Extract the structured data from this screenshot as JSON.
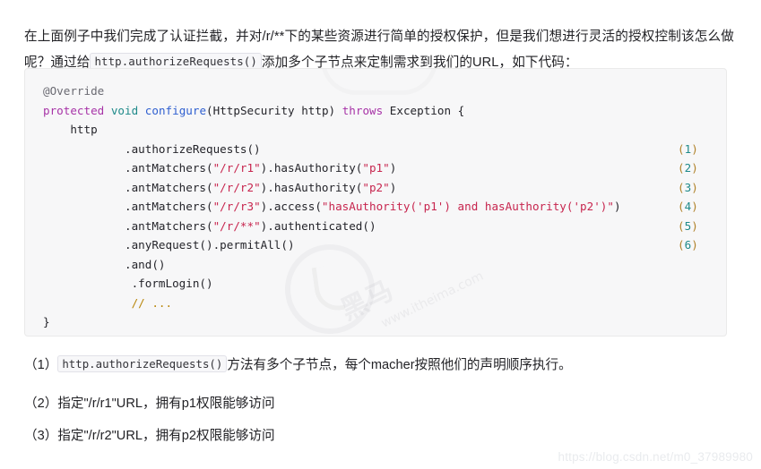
{
  "intro": {
    "part1": "在上面例子中我们完成了认证拦截，并对/r/**下的某些资源进行简单的授权保护，但是我们想进行灵活的授权控制该怎么做呢？通过给",
    "inline_code": "http.authorizeRequests()",
    "part2": "添加多个子节点来定制需求到我们的URL，如下代码："
  },
  "code_block": {
    "language": "java",
    "lines": [
      {
        "indent": 0,
        "tokens": [
          {
            "t": "@Override",
            "c": "anno"
          }
        ],
        "marker": ""
      },
      {
        "indent": 0,
        "tokens": [
          {
            "t": "protected",
            "c": "kw"
          },
          {
            "t": " ",
            "c": "plain"
          },
          {
            "t": "void",
            "c": "type"
          },
          {
            "t": " ",
            "c": "plain"
          },
          {
            "t": "configure",
            "c": "fn"
          },
          {
            "t": "(",
            "c": "punc"
          },
          {
            "t": "HttpSecurity http",
            "c": "plain"
          },
          {
            "t": ")",
            "c": "punc"
          },
          {
            "t": " ",
            "c": "plain"
          },
          {
            "t": "throws",
            "c": "kw"
          },
          {
            "t": " Exception ",
            "c": "plain"
          },
          {
            "t": "{",
            "c": "punc"
          }
        ],
        "marker": ""
      },
      {
        "indent": 1,
        "tokens": [
          {
            "t": "http",
            "c": "plain"
          }
        ],
        "marker": ""
      },
      {
        "indent": 3,
        "tokens": [
          {
            "t": ".authorizeRequests()",
            "c": "mth"
          }
        ],
        "marker": "1"
      },
      {
        "indent": 3,
        "tokens": [
          {
            "t": ".antMatchers(",
            "c": "mth"
          },
          {
            "t": "\"/r/r1\"",
            "c": "str"
          },
          {
            "t": ").hasAuthority(",
            "c": "mth"
          },
          {
            "t": "\"p1\"",
            "c": "str"
          },
          {
            "t": ")",
            "c": "mth"
          }
        ],
        "marker": "2"
      },
      {
        "indent": 3,
        "tokens": [
          {
            "t": ".antMatchers(",
            "c": "mth"
          },
          {
            "t": "\"/r/r2\"",
            "c": "str"
          },
          {
            "t": ").hasAuthority(",
            "c": "mth"
          },
          {
            "t": "\"p2\"",
            "c": "str"
          },
          {
            "t": ")",
            "c": "mth"
          }
        ],
        "marker": "3"
      },
      {
        "indent": 3,
        "tokens": [
          {
            "t": ".antMatchers(",
            "c": "mth"
          },
          {
            "t": "\"/r/r3\"",
            "c": "str"
          },
          {
            "t": ").access(",
            "c": "mth"
          },
          {
            "t": "\"hasAuthority('p1') and hasAuthority('p2')\"",
            "c": "str"
          },
          {
            "t": ")",
            "c": "mth"
          }
        ],
        "marker": "4"
      },
      {
        "indent": 3,
        "tokens": [
          {
            "t": ".antMatchers(",
            "c": "mth"
          },
          {
            "t": "\"/r/**\"",
            "c": "str"
          },
          {
            "t": ").authenticated()",
            "c": "mth"
          }
        ],
        "marker": "5"
      },
      {
        "indent": 3,
        "tokens": [
          {
            "t": ".anyRequest().permitAll()",
            "c": "mth"
          }
        ],
        "marker": "6"
      },
      {
        "indent": 3,
        "tokens": [
          {
            "t": ".and()",
            "c": "mth"
          }
        ],
        "marker": ""
      },
      {
        "indent": 3,
        "tokens": [
          {
            "t": " .formLogin()",
            "c": "mth"
          }
        ],
        "marker": ""
      },
      {
        "indent": 3,
        "tokens": [
          {
            "t": " // ...",
            "c": "cmt"
          }
        ],
        "marker": ""
      },
      {
        "indent": 0,
        "tokens": [
          {
            "t": "}",
            "c": "punc"
          }
        ],
        "marker": ""
      }
    ],
    "markers": [
      "(1)",
      "(2)",
      "(3)",
      "(4)",
      "(5)",
      "(6)"
    ]
  },
  "notes": {
    "note1_prefix": "（1）",
    "note1_code": "http.authorizeRequests()",
    "note1_suffix": "方法有多个子节点，每个macher按照他们的声明顺序执行。",
    "note2": "（2）指定\"/r/r1\"URL，拥有p1权限能够访问",
    "note3": "（3）指定\"/r/r2\"URL，拥有p2权限能够访问"
  },
  "watermarks": {
    "csdn": "https://blog.csdn.net/m0_37989980",
    "brand_cn": "黑马",
    "brand_url": "www.itheima.com"
  },
  "colors": {
    "code_bg": "#f7f7f8",
    "code_border": "#eaeaea",
    "string": "#c7254e",
    "keyword": "#a733a7",
    "type": "#1f8a8a",
    "function": "#2f5fd0",
    "comment": "#b8860b",
    "marker_paren": "#b0822a",
    "marker_num": "#1f8a8a",
    "text": "#222226",
    "watermark": "#e9ebee"
  }
}
